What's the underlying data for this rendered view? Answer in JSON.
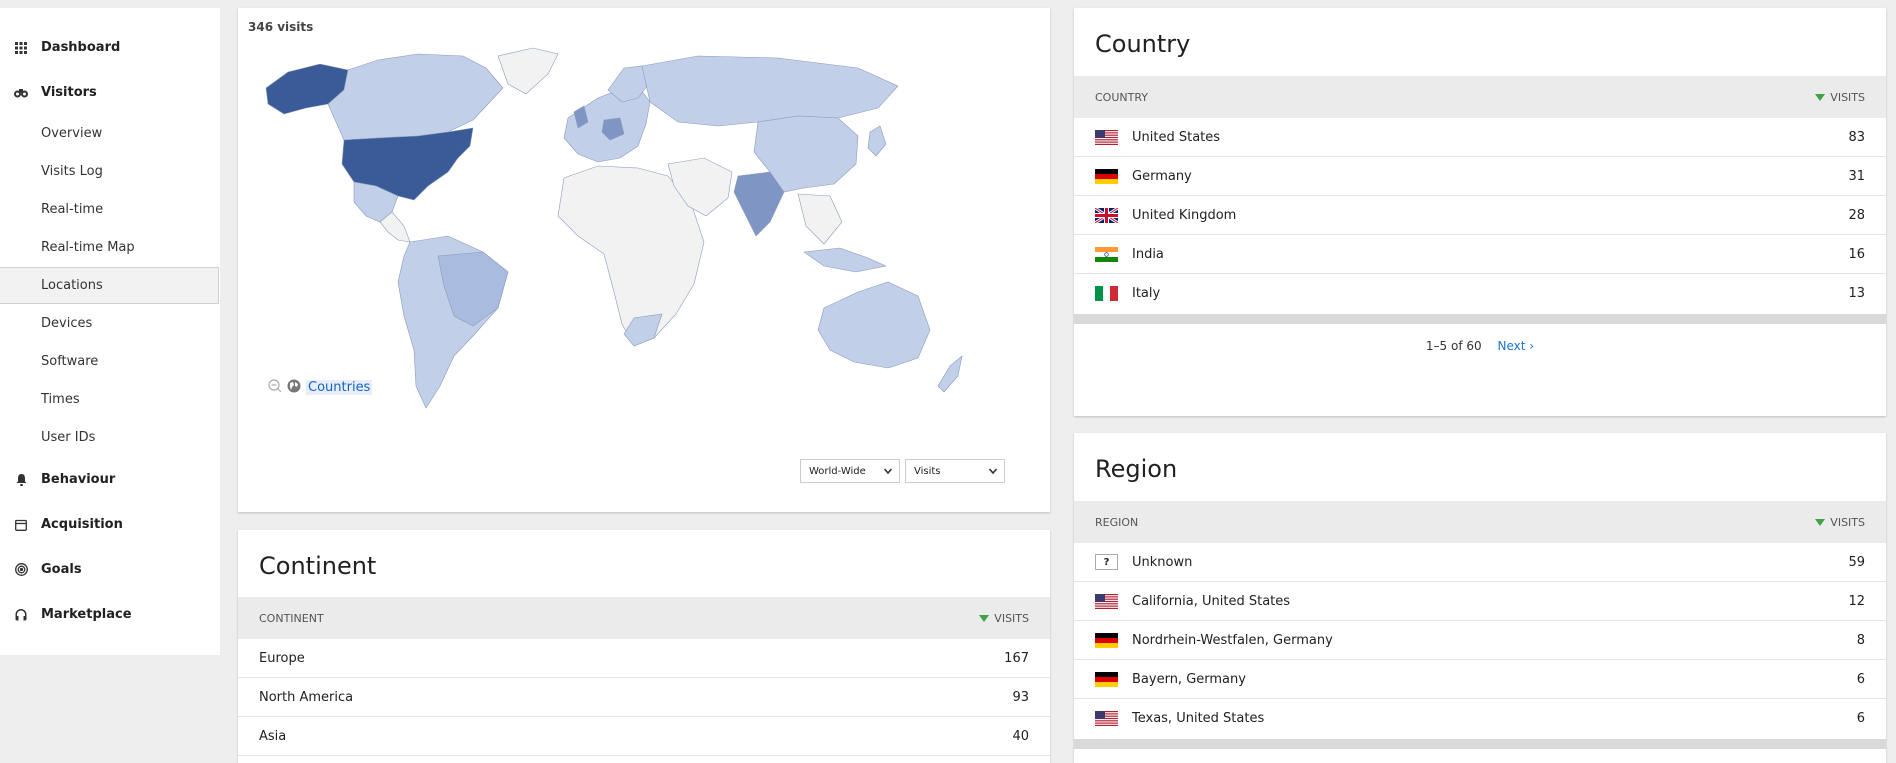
{
  "sidebar": {
    "dashboard": "Dashboard",
    "visitors": "Visitors",
    "sub": [
      "Overview",
      "Visits Log",
      "Real-time",
      "Real-time Map",
      "Locations",
      "Devices",
      "Software",
      "Times",
      "User IDs"
    ],
    "behaviour": "Behaviour",
    "acquisition": "Acquisition",
    "goals": "Goals",
    "marketplace": "Marketplace"
  },
  "map": {
    "visits_label": "346 visits",
    "countries_link": "Countries",
    "region_select": "World-Wide",
    "metric_select": "Visits",
    "colors": {
      "high": "#3a5a98",
      "mid": "#7f96c4",
      "low": "#c2cfe8",
      "none": "#f2f2f2"
    }
  },
  "continent": {
    "title": "Continent",
    "col_label": "CONTINENT",
    "col_value": "VISITS",
    "rows": [
      {
        "label": "Europe",
        "value": "167"
      },
      {
        "label": "North America",
        "value": "93"
      },
      {
        "label": "Asia",
        "value": "40"
      }
    ]
  },
  "country": {
    "title": "Country",
    "col_label": "COUNTRY",
    "col_value": "VISITS",
    "rows": [
      {
        "label": "United States",
        "value": "83",
        "flag": "us"
      },
      {
        "label": "Germany",
        "value": "31",
        "flag": "de"
      },
      {
        "label": "United Kingdom",
        "value": "28",
        "flag": "gb"
      },
      {
        "label": "India",
        "value": "16",
        "flag": "in"
      },
      {
        "label": "Italy",
        "value": "13",
        "flag": "it"
      }
    ],
    "pagination": "1–5 of 60",
    "next": "Next ›"
  },
  "region": {
    "title": "Region",
    "col_label": "REGION",
    "col_value": "VISITS",
    "rows": [
      {
        "label": "Unknown",
        "value": "59",
        "flag": "unknown"
      },
      {
        "label": "California, United States",
        "value": "12",
        "flag": "us"
      },
      {
        "label": "Nordrhein-Westfalen, Germany",
        "value": "8",
        "flag": "de"
      },
      {
        "label": "Bayern, Germany",
        "value": "6",
        "flag": "de"
      },
      {
        "label": "Texas, United States",
        "value": "6",
        "flag": "us"
      }
    ]
  }
}
